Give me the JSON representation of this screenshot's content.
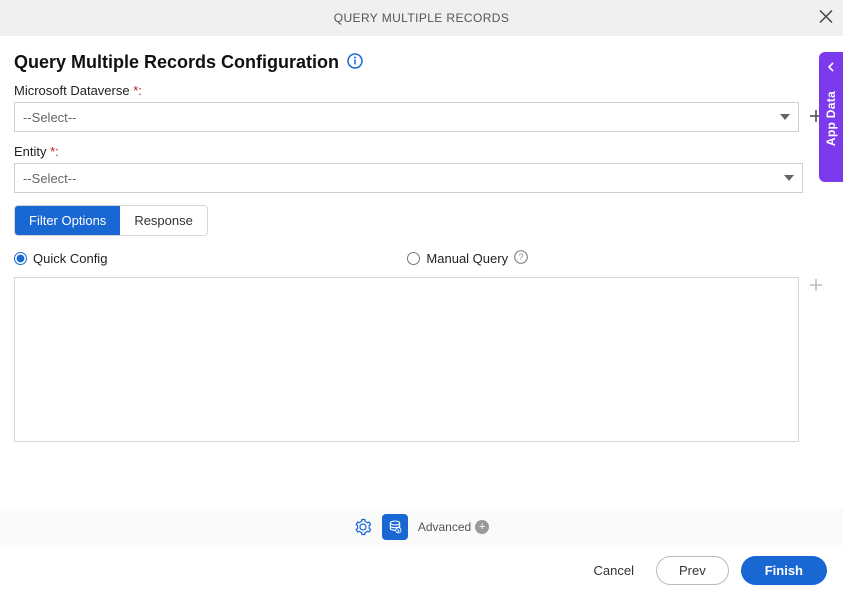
{
  "header": {
    "title": "QUERY MULTIPLE RECORDS"
  },
  "page": {
    "title": "Query Multiple Records Configuration"
  },
  "fields": {
    "dataverse": {
      "label": "Microsoft Dataverse ",
      "required_marker": "*:",
      "placeholder": "--Select--"
    },
    "entity": {
      "label": "Entity ",
      "required_marker": "*:",
      "placeholder": "--Select--"
    }
  },
  "tabs": {
    "filter": "Filter Options",
    "response": "Response"
  },
  "radios": {
    "quick": "Quick Config",
    "manual": "Manual Query"
  },
  "sideTab": {
    "label": "App Data"
  },
  "toolbar": {
    "advanced": "Advanced"
  },
  "footer": {
    "cancel": "Cancel",
    "prev": "Prev",
    "finish": "Finish"
  }
}
